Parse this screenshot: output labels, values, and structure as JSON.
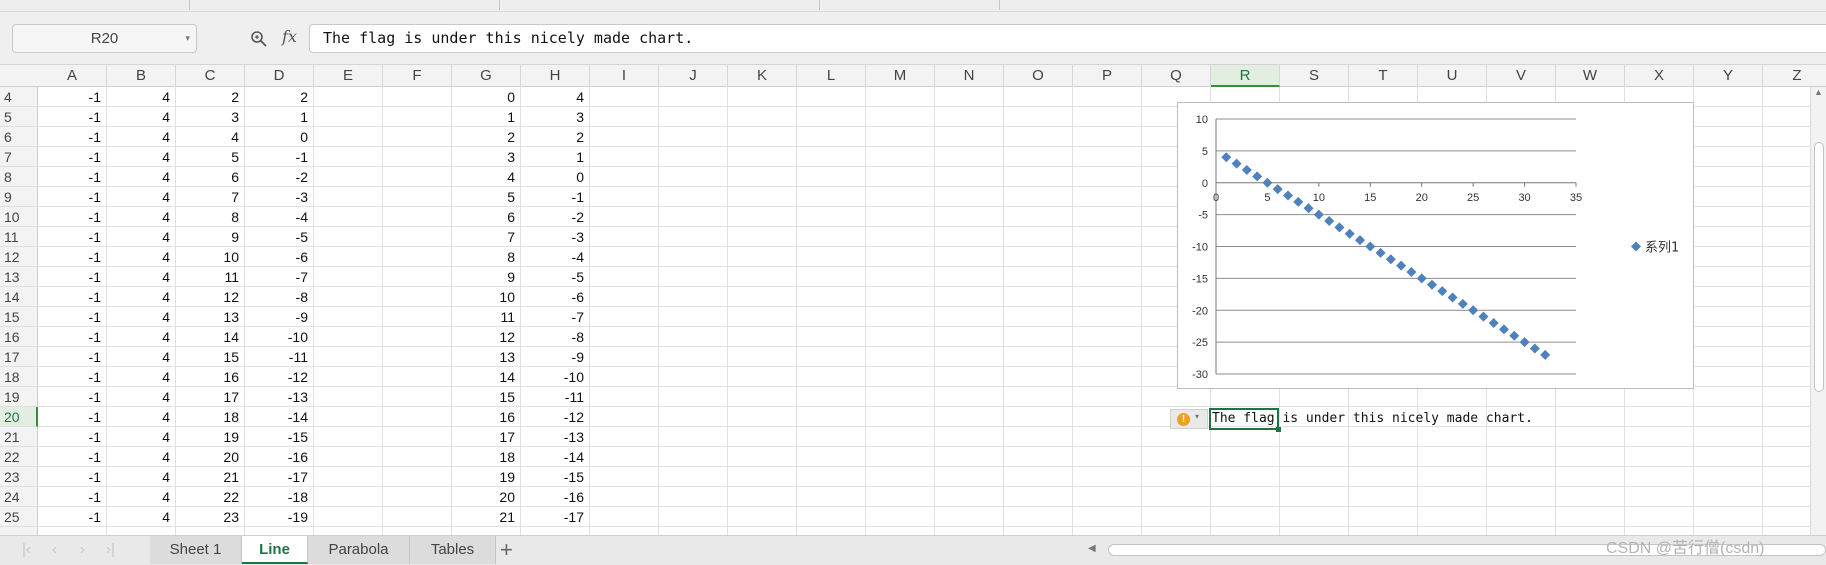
{
  "formula_bar": {
    "name_box": "R20",
    "fx_label": "fx",
    "formula": "The flag is under this nicely made chart."
  },
  "columns": [
    "A",
    "B",
    "C",
    "D",
    "E",
    "F",
    "G",
    "H",
    "I",
    "J",
    "K",
    "L",
    "M",
    "N",
    "O",
    "P",
    "Q",
    "R",
    "S",
    "T",
    "U",
    "V",
    "W",
    "X",
    "Y",
    "Z"
  ],
  "active_column": "R",
  "active_row": "20",
  "rows": [
    "4",
    "5",
    "6",
    "7",
    "8",
    "9",
    "10",
    "11",
    "12",
    "13",
    "14",
    "15",
    "16",
    "17",
    "18",
    "19",
    "20",
    "21",
    "22",
    "23",
    "24",
    "25"
  ],
  "table": {
    "A": [
      "-1",
      "-1",
      "-1",
      "-1",
      "-1",
      "-1",
      "-1",
      "-1",
      "-1",
      "-1",
      "-1",
      "-1",
      "-1",
      "-1",
      "-1",
      "-1",
      "-1",
      "-1",
      "-1",
      "-1",
      "-1",
      "-1"
    ],
    "B": [
      "4",
      "4",
      "4",
      "4",
      "4",
      "4",
      "4",
      "4",
      "4",
      "4",
      "4",
      "4",
      "4",
      "4",
      "4",
      "4",
      "4",
      "4",
      "4",
      "4",
      "4",
      "4"
    ],
    "C": [
      "2",
      "3",
      "4",
      "5",
      "6",
      "7",
      "8",
      "9",
      "10",
      "11",
      "12",
      "13",
      "14",
      "15",
      "16",
      "17",
      "18",
      "19",
      "20",
      "21",
      "22",
      "23"
    ],
    "D": [
      "2",
      "1",
      "0",
      "-1",
      "-2",
      "-3",
      "-4",
      "-5",
      "-6",
      "-7",
      "-8",
      "-9",
      "-10",
      "-11",
      "-12",
      "-13",
      "-14",
      "-15",
      "-16",
      "-17",
      "-18",
      "-19"
    ],
    "G": [
      "0",
      "1",
      "2",
      "3",
      "4",
      "5",
      "6",
      "7",
      "8",
      "9",
      "10",
      "11",
      "12",
      "13",
      "14",
      "15",
      "16",
      "17",
      "18",
      "19",
      "20",
      "21"
    ],
    "H": [
      "4",
      "3",
      "2",
      "1",
      "0",
      "-1",
      "-2",
      "-3",
      "-4",
      "-5",
      "-6",
      "-7",
      "-8",
      "-9",
      "-10",
      "-11",
      "-12",
      "-13",
      "-14",
      "-15",
      "-16",
      "-17"
    ]
  },
  "r20_text": "The flag is under this nicely made chart.",
  "chart_data": {
    "type": "scatter",
    "title": "",
    "xlabel": "",
    "ylabel": "",
    "xlim": [
      0,
      35
    ],
    "ylim": [
      -30,
      10
    ],
    "x_ticks": [
      "0",
      "5",
      "10",
      "15",
      "20",
      "25",
      "30",
      "35"
    ],
    "y_ticks": [
      "10",
      "5",
      "0",
      "-5",
      "-10",
      "-15",
      "-20",
      "-25",
      "-30"
    ],
    "grid": true,
    "legend": "right",
    "series": [
      {
        "name": "系列1",
        "color": "#4f81bd",
        "marker": "diamond",
        "x": [
          1,
          2,
          3,
          4,
          5,
          6,
          7,
          8,
          9,
          10,
          11,
          12,
          13,
          14,
          15,
          16,
          17,
          18,
          19,
          20,
          21,
          22,
          23,
          24,
          25,
          26,
          27,
          28,
          29,
          30,
          31,
          32
        ],
        "y": [
          4,
          3,
          2,
          1,
          0,
          -1,
          -2,
          -3,
          -4,
          -5,
          -6,
          -7,
          -8,
          -9,
          -10,
          -11,
          -12,
          -13,
          -14,
          -15,
          -16,
          -17,
          -18,
          -19,
          -20,
          -21,
          -22,
          -23,
          -24,
          -25,
          -26,
          -27
        ]
      }
    ]
  },
  "sheets": {
    "tabs": [
      "Sheet 1",
      "Line",
      "Parabola",
      "Tables"
    ],
    "active": "Line"
  },
  "watermark": "CSDN @苦行僧(csdn)"
}
